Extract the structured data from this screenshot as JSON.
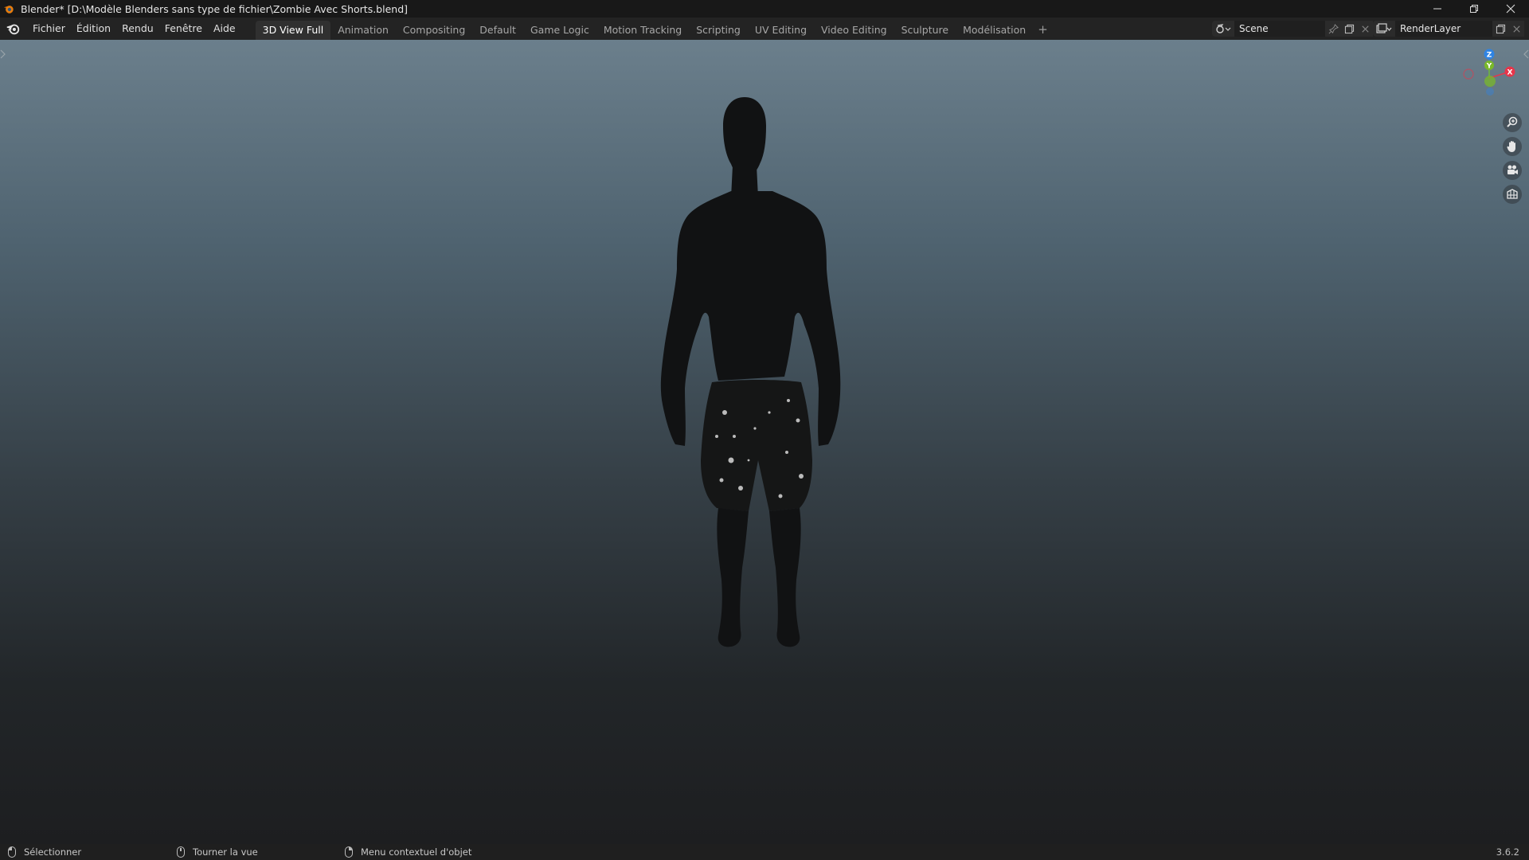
{
  "window": {
    "title": "Blender* [D:\\Modèle Blenders sans type de fichier\\Zombie Avec Shorts.blend]",
    "controls": [
      "minimize-icon",
      "restore-icon",
      "close-icon"
    ]
  },
  "menu": {
    "items": [
      "Fichier",
      "Édition",
      "Rendu",
      "Fenêtre",
      "Aide"
    ]
  },
  "workspaces": {
    "tabs": [
      {
        "label": "3D View Full",
        "active": true
      },
      {
        "label": "Animation",
        "active": false
      },
      {
        "label": "Compositing",
        "active": false
      },
      {
        "label": "Default",
        "active": false
      },
      {
        "label": "Game Logic",
        "active": false
      },
      {
        "label": "Motion Tracking",
        "active": false
      },
      {
        "label": "Scripting",
        "active": false
      },
      {
        "label": "UV Editing",
        "active": false
      },
      {
        "label": "Video Editing",
        "active": false
      },
      {
        "label": "Sculpture",
        "active": false
      },
      {
        "label": "Modélisation",
        "active": false
      }
    ],
    "add_label": "+"
  },
  "scene": {
    "name": "Scene"
  },
  "view_layer": {
    "name": "RenderLayer"
  },
  "gizmo": {
    "axes": [
      "Z",
      "Y",
      "X"
    ],
    "colors": {
      "x": "#e8354a",
      "y": "#79b82a",
      "z": "#2f84e3"
    }
  },
  "nav_tools": [
    "zoom-icon",
    "hand-pan-icon",
    "camera-icon",
    "grid-ortho-icon"
  ],
  "status": {
    "select": "Sélectionner",
    "rotate": "Tourner la vue",
    "context_menu": "Menu contextuel d'objet",
    "version": "3.6.2"
  }
}
